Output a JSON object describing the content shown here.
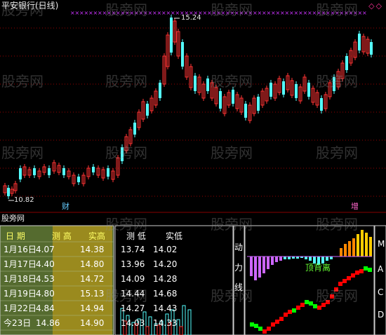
{
  "header": {
    "title": "平安银行(日线)",
    "corner_marks": "◇◇",
    "high_price_label": "15.24",
    "low_price_label": "10.82",
    "event_cai": "财",
    "event_zeng": "增"
  },
  "sub_panel": {
    "title": "股旁网",
    "table": {
      "col_date": "日 期",
      "col_pred_high": "测 高",
      "col_real_high": "实高",
      "col_pred_low": "测 低",
      "col_real_low": "实低",
      "rows": [
        {
          "date": "1月16日",
          "pred_high": "4.07",
          "real_high": "14.38",
          "pred_low": "13.74",
          "real_low": "14.02"
        },
        {
          "date": "1月17日",
          "pred_high": "4.40",
          "real_high": "14.80",
          "pred_low": "13.96",
          "real_low": "14.20"
        },
        {
          "date": "1月18日",
          "pred_high": "4.53",
          "real_high": "14.72",
          "pred_low": "14.09",
          "real_low": "14.28"
        },
        {
          "date": "1月19日",
          "pred_high": "4.80",
          "real_high": "15.13",
          "pred_low": "14.44",
          "real_low": "14.68"
        },
        {
          "date": "1月22日",
          "pred_high": "4.84",
          "real_high": "14.94",
          "pred_low": "14.27",
          "real_low": "14.43"
        },
        {
          "date": "今23日",
          "pred_high": "14.86",
          "real_high": "14.90",
          "pred_low": "14.03",
          "real_low": "14.33"
        }
      ]
    },
    "mid_labels": [
      "动",
      "力",
      "线"
    ],
    "right_labels": [
      "M",
      "A",
      "C",
      "D"
    ],
    "divergence_label": "顶背离"
  },
  "watermark": "股旁网",
  "colors": {
    "background": "#000000",
    "up_candle": "#ff3333",
    "down_candle": "#55ffff",
    "grid": "#990000",
    "marker": "#cc33ff",
    "table_bg": "#556b2f",
    "table_highlight": "#9a8a1e",
    "macd_red": "#ff0000",
    "macd_green": "#00ff00",
    "bar_orange": "#ff8800",
    "bar_yellow": "#ffcc00",
    "bar_violet": "#cc66ff"
  }
}
